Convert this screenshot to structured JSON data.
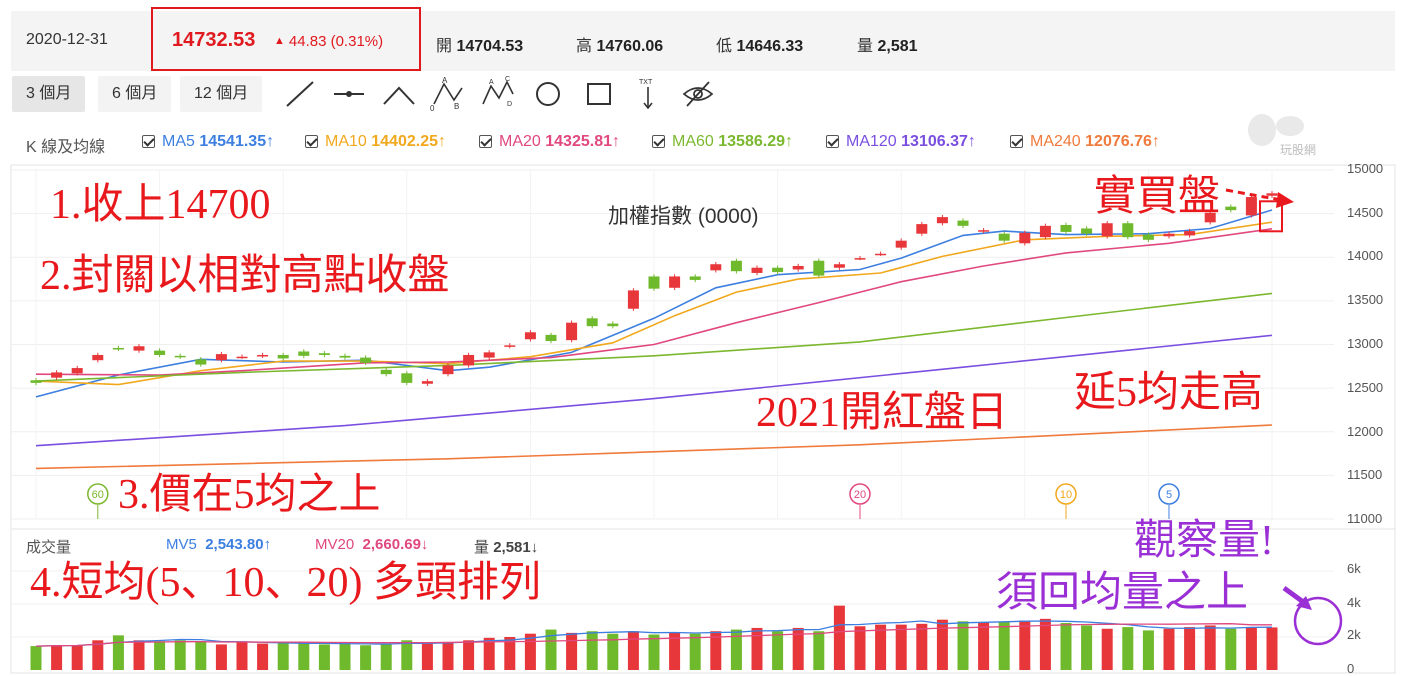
{
  "quote": {
    "date": "2020-12-31",
    "price": "14732.53",
    "change": "44.83 (0.31%)",
    "change_arrow": "▲",
    "open_label": "開",
    "open": "14704.53",
    "high_label": "高",
    "high": "14760.06",
    "low_label": "低",
    "low": "14646.33",
    "vol_label": "量",
    "vol": "2,581"
  },
  "toolbar": {
    "ranges": [
      "3 個月",
      "6 個月",
      "12 個月"
    ],
    "tools": [
      "line-tool-icon",
      "segment-tool-icon",
      "angle-tool-icon",
      "abc-pattern-icon",
      "abcd-pattern-icon",
      "circle-tool-icon",
      "rectangle-tool-icon",
      "text-tool-icon",
      "hide-icon"
    ],
    "abc_letters": [
      "A",
      "B",
      "C",
      "D",
      "0"
    ],
    "txt_label": "TXT"
  },
  "ma_row": {
    "title": "K 線及均線",
    "items": [
      {
        "name": "MA5",
        "value": "14541.35",
        "arrow": "↑",
        "color": "#3d7fe0"
      },
      {
        "name": "MA10",
        "value": "14402.25",
        "arrow": "↑",
        "color": "#f2a81d"
      },
      {
        "name": "MA20",
        "value": "14325.81",
        "arrow": "↑",
        "color": "#e0487f"
      },
      {
        "name": "MA60",
        "value": "13586.29",
        "arrow": "↑",
        "color": "#7cb82f"
      },
      {
        "name": "MA120",
        "value": "13106.37",
        "arrow": "↑",
        "color": "#7a4fe0"
      },
      {
        "name": "MA240",
        "value": "12076.76",
        "arrow": "↑",
        "color": "#f07a3c"
      }
    ]
  },
  "watermark_text": "玩股網",
  "chart_data": [
    {
      "type": "candlestick",
      "title": "加權指數 (0000)",
      "yticks": [
        15000,
        14500,
        14000,
        13500,
        13000,
        12500,
        12000,
        11500,
        11000
      ],
      "ylim": [
        11000,
        15000
      ],
      "candles": [
        {
          "o": 12590,
          "c": 12560
        },
        {
          "o": 12620,
          "c": 12680
        },
        {
          "o": 12670,
          "c": 12730
        },
        {
          "o": 12820,
          "c": 12880
        },
        {
          "o": 12960,
          "c": 12950
        },
        {
          "o": 12930,
          "c": 12980
        },
        {
          "o": 12930,
          "c": 12880
        },
        {
          "o": 12870,
          "c": 12860
        },
        {
          "o": 12830,
          "c": 12770
        },
        {
          "o": 12820,
          "c": 12890
        },
        {
          "o": 12860,
          "c": 12860
        },
        {
          "o": 12870,
          "c": 12880
        },
        {
          "o": 12880,
          "c": 12840
        },
        {
          "o": 12920,
          "c": 12870
        },
        {
          "o": 12900,
          "c": 12880
        },
        {
          "o": 12870,
          "c": 12850
        },
        {
          "o": 12850,
          "c": 12790
        },
        {
          "o": 12710,
          "c": 12660
        },
        {
          "o": 12670,
          "c": 12560
        },
        {
          "o": 12550,
          "c": 12580
        },
        {
          "o": 12660,
          "c": 12760
        },
        {
          "o": 12760,
          "c": 12880
        },
        {
          "o": 12850,
          "c": 12910
        },
        {
          "o": 12980,
          "c": 12990
        },
        {
          "o": 13060,
          "c": 13140
        },
        {
          "o": 13110,
          "c": 13040
        },
        {
          "o": 13050,
          "c": 13250
        },
        {
          "o": 13300,
          "c": 13210
        },
        {
          "o": 13240,
          "c": 13210
        },
        {
          "o": 13410,
          "c": 13620
        },
        {
          "o": 13780,
          "c": 13640
        },
        {
          "o": 13650,
          "c": 13780
        },
        {
          "o": 13780,
          "c": 13740
        },
        {
          "o": 13850,
          "c": 13920
        },
        {
          "o": 13960,
          "c": 13840
        },
        {
          "o": 13820,
          "c": 13880
        },
        {
          "o": 13880,
          "c": 13830
        },
        {
          "o": 13860,
          "c": 13900
        },
        {
          "o": 13960,
          "c": 13790
        },
        {
          "o": 13880,
          "c": 13920
        },
        {
          "o": 13990,
          "c": 13990
        },
        {
          "o": 14040,
          "c": 14040
        },
        {
          "o": 14110,
          "c": 14190
        },
        {
          "o": 14270,
          "c": 14380
        },
        {
          "o": 14390,
          "c": 14460
        },
        {
          "o": 14420,
          "c": 14360
        },
        {
          "o": 14300,
          "c": 14310
        },
        {
          "o": 14270,
          "c": 14190
        },
        {
          "o": 14160,
          "c": 14280
        },
        {
          "o": 14230,
          "c": 14360
        },
        {
          "o": 14370,
          "c": 14290
        },
        {
          "o": 14330,
          "c": 14270
        },
        {
          "o": 14240,
          "c": 14390
        },
        {
          "o": 14390,
          "c": 14230
        },
        {
          "o": 14260,
          "c": 14200
        },
        {
          "o": 14240,
          "c": 14270
        },
        {
          "o": 14250,
          "c": 14300
        },
        {
          "o": 14400,
          "c": 14510
        },
        {
          "o": 14580,
          "c": 14540
        },
        {
          "o": 14480,
          "c": 14690
        },
        {
          "o": 14705,
          "c": 14733
        }
      ],
      "ma_lines": [
        {
          "name": "MA5",
          "color": "#3d7fe0",
          "points": [
            [
              0,
              12400
            ],
            [
              4,
              12650
            ],
            [
              8,
              12830
            ],
            [
              12,
              12800
            ],
            [
              16,
              12820
            ],
            [
              20,
              12700
            ],
            [
              22,
              12740
            ],
            [
              26,
              12910
            ],
            [
              30,
              13300
            ],
            [
              33,
              13650
            ],
            [
              36,
              13800
            ],
            [
              40,
              13860
            ],
            [
              42,
              13990
            ],
            [
              45,
              14250
            ],
            [
              47,
              14300
            ],
            [
              50,
              14260
            ],
            [
              54,
              14270
            ],
            [
              57,
              14330
            ],
            [
              60,
              14541
            ]
          ]
        },
        {
          "name": "MA10",
          "color": "#f2a81d",
          "points": [
            [
              0,
              12580
            ],
            [
              4,
              12540
            ],
            [
              8,
              12700
            ],
            [
              12,
              12810
            ],
            [
              16,
              12810
            ],
            [
              20,
              12780
            ],
            [
              24,
              12860
            ],
            [
              28,
              13020
            ],
            [
              31,
              13330
            ],
            [
              34,
              13600
            ],
            [
              37,
              13750
            ],
            [
              41,
              13820
            ],
            [
              44,
              14010
            ],
            [
              48,
              14200
            ],
            [
              52,
              14240
            ],
            [
              56,
              14260
            ],
            [
              60,
              14402
            ]
          ]
        },
        {
          "name": "MA20",
          "color": "#e0487f",
          "points": [
            [
              0,
              12660
            ],
            [
              6,
              12650
            ],
            [
              10,
              12700
            ],
            [
              16,
              12790
            ],
            [
              20,
              12800
            ],
            [
              25,
              12850
            ],
            [
              30,
              13000
            ],
            [
              34,
              13250
            ],
            [
              38,
              13480
            ],
            [
              42,
              13720
            ],
            [
              46,
              13900
            ],
            [
              50,
              14050
            ],
            [
              55,
              14160
            ],
            [
              60,
              14326
            ]
          ]
        },
        {
          "name": "MA60",
          "color": "#7cb82f",
          "points": [
            [
              0,
              12580
            ],
            [
              10,
              12680
            ],
            [
              20,
              12760
            ],
            [
              30,
              12870
            ],
            [
              40,
              13030
            ],
            [
              50,
              13310
            ],
            [
              60,
              13586
            ]
          ]
        },
        {
          "name": "MA120",
          "color": "#7a4fe0",
          "points": [
            [
              0,
              11840
            ],
            [
              15,
              12070
            ],
            [
              30,
              12380
            ],
            [
              45,
              12740
            ],
            [
              60,
              13106
            ]
          ]
        },
        {
          "name": "MA240",
          "color": "#f07a3c",
          "points": [
            [
              0,
              11580
            ],
            [
              20,
              11690
            ],
            [
              40,
              11850
            ],
            [
              60,
              12077
            ]
          ]
        }
      ],
      "ma_markers": [
        {
          "label": "60",
          "color": "#7cb82f",
          "index": 3
        },
        {
          "label": "20",
          "color": "#e0487f",
          "index": 40
        },
        {
          "label": "10",
          "color": "#f2a81d",
          "index": 50
        },
        {
          "label": "5",
          "color": "#3d7fe0",
          "index": 55
        }
      ]
    },
    {
      "type": "bar",
      "title": "成交量",
      "yticks": [
        "6k",
        "4k",
        "2k",
        "0"
      ],
      "ylim": [
        0,
        6000
      ],
      "values": [
        1450,
        1500,
        1500,
        1800,
        2100,
        1800,
        1750,
        1800,
        1750,
        1550,
        1700,
        1600,
        1650,
        1600,
        1550,
        1600,
        1500,
        1600,
        1800,
        1600,
        1700,
        1800,
        1950,
        2000,
        2200,
        2450,
        2250,
        2350,
        2200,
        2350,
        2150,
        2300,
        2200,
        2350,
        2450,
        2550,
        2350,
        2550,
        2350,
        3900,
        2650,
        2750,
        2750,
        2800,
        3050,
        2950,
        2900,
        2900,
        3000,
        3100,
        2850,
        2700,
        2500,
        2600,
        2400,
        2500,
        2600,
        2700,
        2500,
        2600,
        2581
      ],
      "mv_lines": [
        {
          "name": "MV5",
          "color": "#3d7fe0"
        },
        {
          "name": "MV20",
          "color": "#e0487f"
        }
      ],
      "legend": {
        "mv5_name": "MV5",
        "mv5_value": "2,543.80",
        "mv5_arrow": "↑",
        "mv20_name": "MV20",
        "mv20_value": "2,660.69",
        "mv20_arrow": "↓",
        "vol_name": "量",
        "vol_value": "2,581",
        "vol_arrow": "↓"
      }
    }
  ],
  "annotations": {
    "a1": "1.收上14700",
    "a2": "2.封關以相對高點收盤",
    "a3": "3.價在5均之上",
    "a4": "4.短均(5、10、20) 多頭排列",
    "a5": "實買盤",
    "a6": "2021開紅盤日",
    "a7": "延5均走高",
    "a8": "觀察量!",
    "a9": "須回均量之上"
  },
  "colors": {
    "up": "#e8373a",
    "down": "#6fba2c",
    "accent": "#e0191f",
    "annot_red": "#e8181c",
    "annot_purple": "#9b2fd6"
  }
}
